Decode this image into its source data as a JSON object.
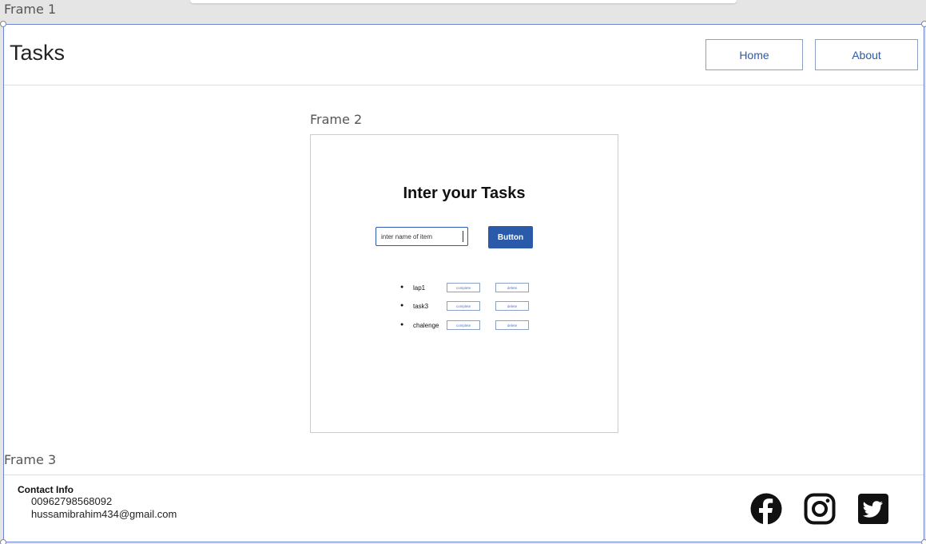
{
  "canvas": {
    "frame1_label": "Frame 1",
    "frame2_label": "Frame 2",
    "frame3_label": "Frame 3"
  },
  "header": {
    "title": "Tasks",
    "nav": {
      "home": "Home",
      "about": "About"
    }
  },
  "main": {
    "title": "Inter your Tasks",
    "input": {
      "value": "inter name of item"
    },
    "add_button": "Button",
    "tasks": [
      {
        "name": "lap1",
        "complete": "complete",
        "delete": "delete"
      },
      {
        "name": "task3",
        "complete": "complete",
        "delete": "delete"
      },
      {
        "name": "chalenge",
        "complete": "complete",
        "delete": "delete"
      }
    ]
  },
  "footer": {
    "contact_title": "Contact Info",
    "phone": "00962798568092",
    "email": "hussamibrahim434@gmail.com",
    "social": [
      "facebook-icon",
      "instagram-icon",
      "twitter-icon"
    ]
  },
  "colors": {
    "accent": "#2b5aab",
    "frame_border": "#6b86d6"
  }
}
